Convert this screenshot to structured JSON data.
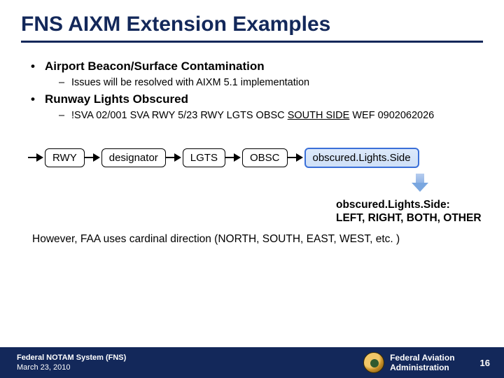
{
  "title": "FNS AIXM Extension Examples",
  "bullets": [
    {
      "text": "Airport Beacon/Surface Contamination",
      "sub": [
        "Issues will be resolved with AIXM 5.1 implementation"
      ]
    },
    {
      "text": "Runway Lights Obscured",
      "sub_parts": {
        "prefix": "!SVA 02/001 SVA RWY 5/23 RWY LGTS OBSC ",
        "underlined": "SOUTH SIDE",
        "suffix": " WEF 0902062026"
      }
    }
  ],
  "diagram": {
    "boxes": [
      "RWY",
      "designator",
      "LGTS",
      "OBSC",
      "obscured.Lights.Side"
    ]
  },
  "enum_block": {
    "label": "obscured.Lights.Side:",
    "values": "LEFT, RIGHT, BOTH, OTHER"
  },
  "faa_note": "However, FAA uses cardinal direction (NORTH, SOUTH, EAST, WEST, etc. )",
  "footer": {
    "system": "Federal NOTAM System (FNS)",
    "date": "March 23, 2010",
    "agency_line1": "Federal Aviation",
    "agency_line2": "Administration",
    "page": "16"
  }
}
